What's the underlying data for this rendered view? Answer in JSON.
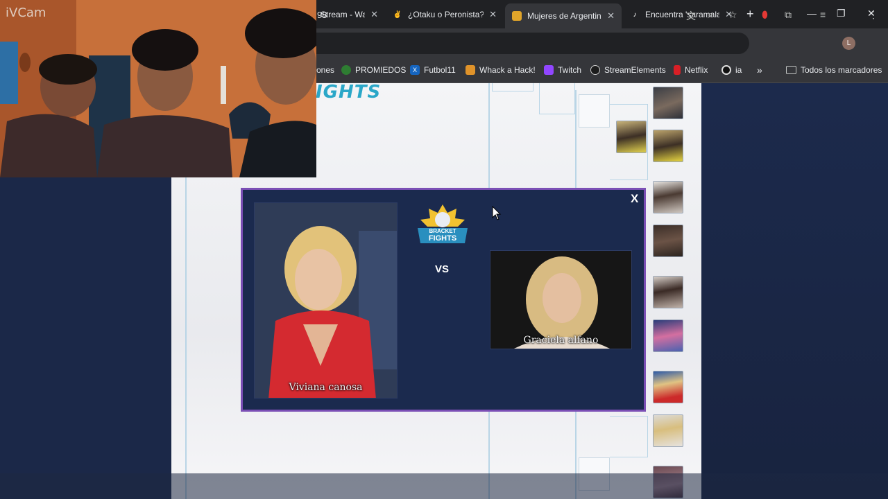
{
  "browser": {
    "tabs": [
      {
        "title": "Stream - Wa",
        "icon": "stream-icon",
        "active": false
      },
      {
        "title": "¿Otaku o Peronista?",
        "icon": "peace-hand-icon",
        "active": false
      },
      {
        "title": "Mujeres de Argentina",
        "icon": "bracket-fights-icon",
        "active": true
      },
      {
        "title": "Encuentra 'saramala",
        "icon": "tiktok-icon",
        "active": false
      }
    ],
    "close_glyph": "✕",
    "new_tab_glyph": "+",
    "url_fragment": "98",
    "bookmarks": [
      {
        "label": "ones",
        "icon": ""
      },
      {
        "label": "PROMIEDOS",
        "icon": "promiedos-icon"
      },
      {
        "label": "Futbol11",
        "icon": "futbol11-icon"
      },
      {
        "label": "Whack a Hack!",
        "icon": "whack-icon"
      },
      {
        "label": "Twitch",
        "icon": "twitch-icon"
      },
      {
        "label": "StreamElements",
        "icon": "streamelements-icon"
      },
      {
        "label": "Netflix",
        "icon": "netflix-icon"
      },
      {
        "label": "ia",
        "icon": "ia-icon"
      }
    ],
    "bookmarks_overflow": "»",
    "all_bookmarks_label": "Todos los marcadores",
    "profile_initial": "L"
  },
  "page": {
    "logo_text_partial": "IGHTS",
    "modal": {
      "close_label": "X",
      "logo_top": "BRACKET",
      "logo_bottom": "FIGHTS",
      "vs_label": "VS",
      "left_contender": "Viviana canosa",
      "right_contender": "Graciela alfano"
    }
  },
  "webcam": {
    "label": "iVCam"
  },
  "colors": {
    "modal_bg": "#1b2a4e",
    "modal_border": "#7b4fb5",
    "page_bg": "#f4f5f7",
    "chrome_dark": "#202124"
  }
}
